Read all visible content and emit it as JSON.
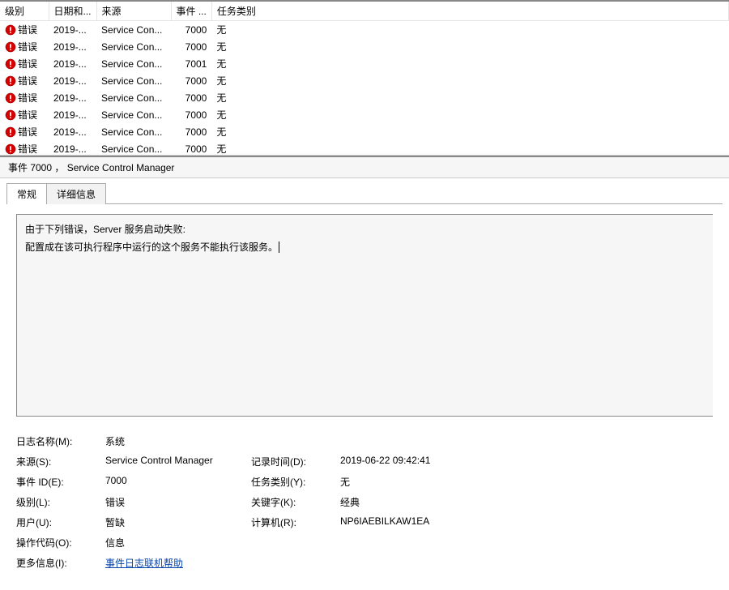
{
  "table": {
    "headers": {
      "level": "级别",
      "date": "日期和...",
      "source": "来源",
      "eventid": "事件 ...",
      "category": "任务类别"
    },
    "rows": [
      {
        "level": "错误",
        "date": "2019-...",
        "source": "Service Con...",
        "eventid": "7000",
        "category": "无"
      },
      {
        "level": "错误",
        "date": "2019-...",
        "source": "Service Con...",
        "eventid": "7000",
        "category": "无"
      },
      {
        "level": "错误",
        "date": "2019-...",
        "source": "Service Con...",
        "eventid": "7001",
        "category": "无"
      },
      {
        "level": "错误",
        "date": "2019-...",
        "source": "Service Con...",
        "eventid": "7000",
        "category": "无"
      },
      {
        "level": "错误",
        "date": "2019-...",
        "source": "Service Con...",
        "eventid": "7000",
        "category": "无"
      },
      {
        "level": "错误",
        "date": "2019-...",
        "source": "Service Con...",
        "eventid": "7000",
        "category": "无"
      },
      {
        "level": "错误",
        "date": "2019-...",
        "source": "Service Con...",
        "eventid": "7000",
        "category": "无"
      },
      {
        "level": "错误",
        "date": "2019-...",
        "source": "Service Con...",
        "eventid": "7000",
        "category": "无"
      }
    ]
  },
  "detail": {
    "title": "事件 7000 ， Service Control Manager",
    "tabs": {
      "general": "常规",
      "details": "详细信息"
    },
    "message_line1": "由于下列错误，Server 服务启动失败:",
    "message_line2": "配置成在该可执行程序中运行的这个服务不能执行该服务。",
    "fields": {
      "log_name_label": "日志名称(M):",
      "log_name_value": "系统",
      "source_label": "来源(S):",
      "source_value": "Service Control Manager",
      "logged_label": "记录时间(D):",
      "logged_value": "2019-06-22 09:42:41",
      "eventid_label": "事件 ID(E):",
      "eventid_value": "7000",
      "category_label": "任务类别(Y):",
      "category_value": "无",
      "level_label": "级别(L):",
      "level_value": "错误",
      "keywords_label": "关键字(K):",
      "keywords_value": "经典",
      "user_label": "用户(U):",
      "user_value": "暂缺",
      "computer_label": "计算机(R):",
      "computer_value": "NP6IAEBILKAW1EA",
      "opcode_label": "操作代码(O):",
      "opcode_value": "信息",
      "more_label": "更多信息(I):",
      "more_link": "事件日志联机帮助"
    }
  }
}
